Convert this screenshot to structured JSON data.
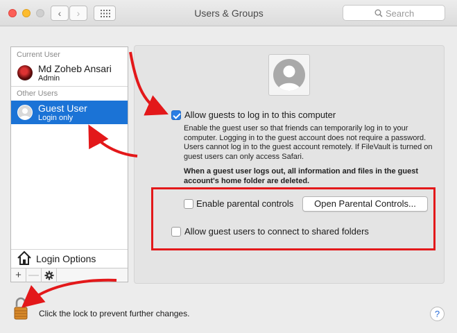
{
  "window": {
    "title": "Users & Groups"
  },
  "toolbar": {
    "search_placeholder": "Search"
  },
  "sidebar": {
    "current_user_heading": "Current User",
    "current_user": {
      "name": "Md Zoheb Ansari",
      "role": "Admin"
    },
    "other_users_heading": "Other Users",
    "other_users": [
      {
        "name": "Guest User",
        "role": "Login only",
        "selected": true
      }
    ],
    "login_options_label": "Login Options",
    "add_label": "+",
    "remove_label": "—"
  },
  "guest_settings": {
    "allow_login": {
      "label": "Allow guests to log in to this computer",
      "checked": true
    },
    "description": "Enable the guest user so that friends can temporarily log in to your computer. Logging in to the guest account does not require a password. Users cannot log in to the guest account remotely. If FileVault is turned on guest users can only access Safari.",
    "warning": "When a guest user logs out, all information and files in the guest account's home folder are deleted.",
    "parental_controls": {
      "label": "Enable parental controls",
      "checked": false
    },
    "open_parental_controls_label": "Open Parental Controls...",
    "shared_folders": {
      "label": "Allow guest users to connect to shared folders",
      "checked": false
    }
  },
  "footer": {
    "lock_text": "Click the lock to prevent further changes.",
    "help_label": "?"
  },
  "colors": {
    "selection": "#1b73d6",
    "annotation": "#e3181a",
    "checkbox_on": "#2a7ee4"
  }
}
